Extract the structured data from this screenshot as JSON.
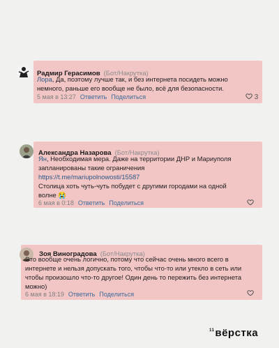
{
  "comments": [
    {
      "author": "Радмир Герасимов",
      "tag": "(Бот/Накрутка)",
      "mention": "Лора",
      "text_line1": ", Да, поэтому лучше так, и без интернета посидеть можно",
      "text_line2": "немного, раньше его вообще не было, всё для безопасности.",
      "date": "5 мая в 13:27",
      "reply": "Ответить",
      "share": "Поделиться",
      "likes": "3"
    },
    {
      "author": "Александра Назарова",
      "tag": "(Бот/Накрутка)",
      "mention": "Ян",
      "text_line1": ", Необходимая мера. Даже на территории ДНР и Мариуполя",
      "text_line2": "запланированы такие ограничения",
      "link": "https://t.me/mariupolnowosti/15587",
      "text_line3": "Столица хоть чуть-чуть побудет с другими городами на одной",
      "text_line4": "волне 😭",
      "date": "6 мая в 0:18",
      "reply": "Ответить",
      "share": "Поделиться"
    },
    {
      "author": "Зоя Виноградова",
      "tag": "(Бот/Накрутка)",
      "text_line1": "Это вообще очень логично, потому что сейчас очень много всего в",
      "text_line2": "интернете и нельзя допускать того, чтобы что-то или утекло в сеть или",
      "text_line3": "чтобы произошло что-то другое! Один день то пережить без интернета",
      "text_line4": "можно)",
      "date": "6 мая в 18:19",
      "reply": "Ответить",
      "share": "Поделиться"
    }
  ],
  "brand": {
    "prefix": "11",
    "name": "вёрстка"
  },
  "colors": {
    "highlight": "#f3c6c6",
    "link": "#2a5885",
    "background": "#f1f1ef"
  }
}
